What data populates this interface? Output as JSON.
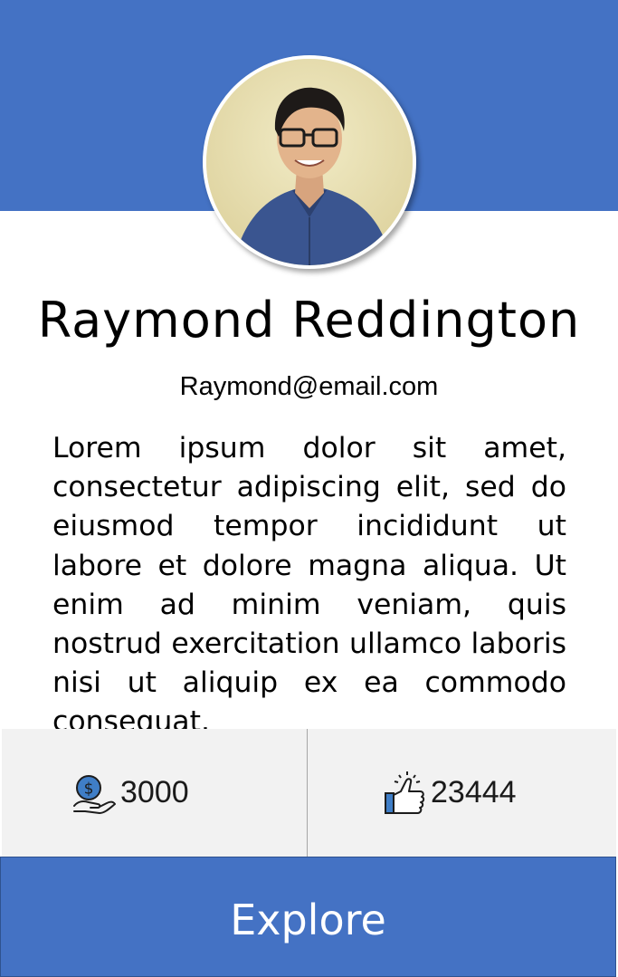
{
  "profile": {
    "name": "Raymond Reddington",
    "email": "Raymond@email.com",
    "bio": "Lorem ipsum dolor sit amet, consectetur adipiscing elit, sed do eiusmod tempor incididunt ut labore et dolore magna aliqua. Ut enim ad minim veniam, quis nostrud exercitation ullamco laboris nisi ut aliquip ex ea commodo consequat."
  },
  "stats": {
    "money": {
      "icon": "money-hand-icon",
      "value": "3000"
    },
    "likes": {
      "icon": "thumbs-up-icon",
      "value": "23444"
    }
  },
  "actions": {
    "explore_label": "Explore"
  },
  "colors": {
    "brand": "#4472c4",
    "stats_background": "#f2f2f2"
  }
}
